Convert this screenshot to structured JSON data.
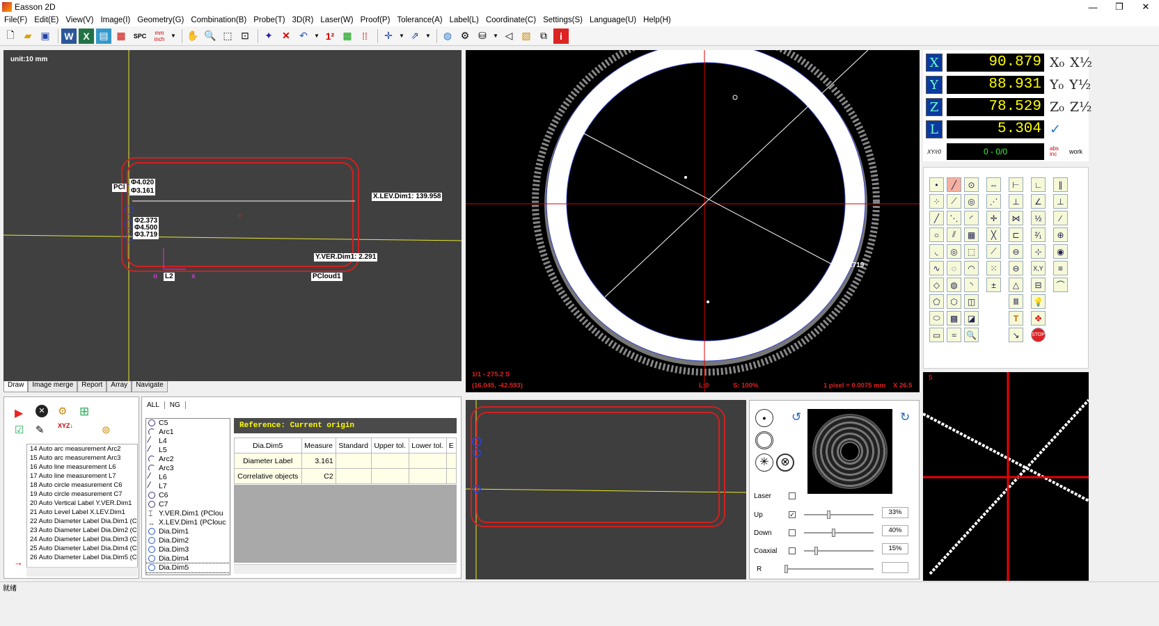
{
  "window": {
    "title": "Easson 2D",
    "min": "—",
    "max": "❐",
    "close": "✕"
  },
  "menu": [
    "File(F)",
    "Edit(E)",
    "View(V)",
    "Image(I)",
    "Geometry(G)",
    "Combination(B)",
    "Probe(T)",
    "3D(R)",
    "Laser(W)",
    "Proof(P)",
    "Tolerance(A)",
    "Label(L)",
    "Coordinate(C)",
    "Settings(S)",
    "Language(U)",
    "Help(H)"
  ],
  "toolbar": {
    "spc": "SPC",
    "mm": "mm",
    "inch": "inch"
  },
  "draw": {
    "unit": "unit:10 mm",
    "dia1": "Φ4.020",
    "dia2": "Φ3.161",
    "dia3": "Φ2.373",
    "dia4": "Φ4.500",
    "dia5": "Φ3.719",
    "pc": "PCl",
    "xlev": "X.LEV.Dim1: 139.958",
    "yver": "Y.VER.Dim1: 2.291",
    "l2": "L2",
    "pcloud": "PCloud1",
    "origin": "o",
    "xaxis": "x"
  },
  "draw_tabs": [
    "Draw",
    "Image merge",
    "Report",
    "Array",
    "Navigate"
  ],
  "camera": {
    "dia": "Φ3.719",
    "info1": "1/1 - 275.2 S",
    "info2": "(16.045, -42.593)",
    "l0": "L:0",
    "scale": "S: 100%",
    "pixel": "1 pixel = 0.0075 mm",
    "zoom": "X 26.5"
  },
  "dro": {
    "axes": [
      {
        "name": "X",
        "value": "90.879",
        "ext1": "X₀",
        "ext2": "X½"
      },
      {
        "name": "Y",
        "value": "88.931",
        "ext1": "Y₀",
        "ext2": "Y½"
      },
      {
        "name": "Z",
        "value": "78.529",
        "ext1": "Z₀",
        "ext2": "Z½"
      },
      {
        "name": "L",
        "value": "5.304",
        "ext1": "✓",
        "ext2": ""
      }
    ],
    "xy_label": "XY/r0",
    "counter": "0 - 0/0",
    "abs": "abs inc",
    "work": "work"
  },
  "zoom_view": {
    "frame": "5"
  },
  "program": {
    "items": [
      "14 Auto arc measurement Arc2",
      "15 Auto arc measurement Arc3",
      "16 Auto line measurement L6",
      "17 Auto line measurement L7",
      "18 Auto circle measurement C6",
      "19 Auto circle measurement C7",
      "20 Auto Vertical Label Y.VER.Dim1",
      "21 Auto Level Label X.LEV.Dim1",
      "22 Auto Diameter Label Dia.Dim1 (C",
      "23 Auto Diameter Label Dia.Dim2 (C",
      "24 Auto Diameter Label Dia.Dim3 (C",
      "25 Auto Diameter Label Dia.Dim4 (C",
      "26 Auto Diameter Label Dia.Dim5 (C"
    ]
  },
  "objects": {
    "tabs": [
      "ALL",
      "NG"
    ],
    "items": [
      "C5",
      "Arc1",
      "L4",
      "L5",
      "Arc2",
      "Arc3",
      "L6",
      "L7",
      "C6",
      "C7",
      "Y.VER.Dim1 (PClou",
      "X.LEV.Dim1 (PClouc",
      "Dia.Dim1",
      "Dia.Dim2",
      "Dia.Dim3",
      "Dia.Dim4",
      "Dia.Dim5"
    ]
  },
  "reference": "Reference: Current origin",
  "props": {
    "headers": [
      "Dia.Dim5",
      "Measure",
      "Standard",
      "Upper tol.",
      "Lower tol.",
      "E"
    ],
    "rows": [
      [
        "Diameter Label",
        "3.161",
        "",
        "",
        "",
        ""
      ],
      [
        "Correlative objects",
        "C2",
        "",
        "",
        "",
        ""
      ]
    ]
  },
  "light": {
    "rows": [
      {
        "label": "Laser",
        "checked": "",
        "pct": ""
      },
      {
        "label": "Up",
        "checked": "✓",
        "pct": "33%",
        "level": 0.33
      },
      {
        "label": "Down",
        "checked": "",
        "pct": "40%",
        "level": 0.4
      },
      {
        "label": "Coaxial",
        "checked": "",
        "pct": "15%",
        "level": 0.15
      },
      {
        "label": "R",
        "checked": "",
        "pct": ""
      }
    ]
  },
  "status": "就绪"
}
